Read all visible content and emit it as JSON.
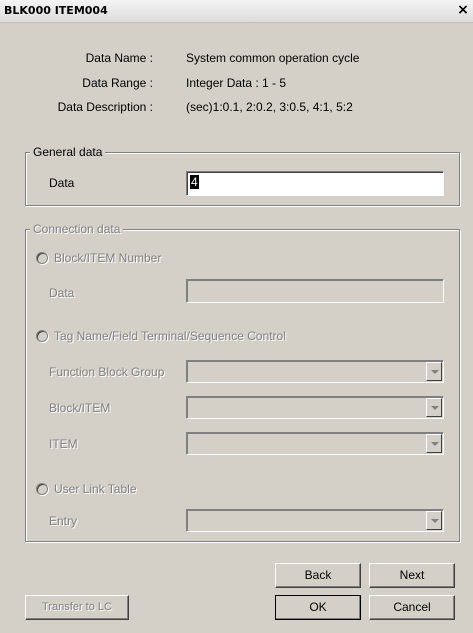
{
  "window": {
    "title": "BLK000 ITEM004",
    "close_glyph": "×"
  },
  "info": {
    "data_name_label": "Data Name :",
    "data_name_value": "System common operation cycle",
    "data_range_label": "Data Range :",
    "data_range_value": "Integer Data : 1 - 5",
    "data_description_label": "Data Description :",
    "data_description_value": "(sec)1:0.1, 2:0.2, 3:0.5, 4:1, 5:2"
  },
  "general": {
    "group_title": "General data",
    "data_label": "Data",
    "data_value": "4"
  },
  "connection": {
    "group_title": "Connection data",
    "block_item_radio_label": "Block/ITEM Number",
    "block_data_label": "Data",
    "block_data_value": "",
    "tag_radio_label": "Tag Name/Field Terminal/Sequence Control",
    "function_block_group_label": "Function Block Group",
    "function_block_group_value": "",
    "block_item_label": "Block/ITEM",
    "block_item_value": "",
    "item_label": "ITEM",
    "item_value": "",
    "user_link_radio_label": "User Link Table",
    "entry_label": "Entry",
    "entry_value": ""
  },
  "buttons": {
    "transfer_label": "Transfer to LC",
    "back_label": "Back",
    "next_label": "Next",
    "ok_label": "OK",
    "cancel_label": "Cancel"
  },
  "colors": {
    "dialog_bg": "#d4d0c8",
    "disabled_text": "#808080",
    "field_bg": "#ffffff"
  },
  "icons": {
    "close": "close-icon",
    "combo": "chevron-down-icon",
    "radio": "radio-icon"
  }
}
